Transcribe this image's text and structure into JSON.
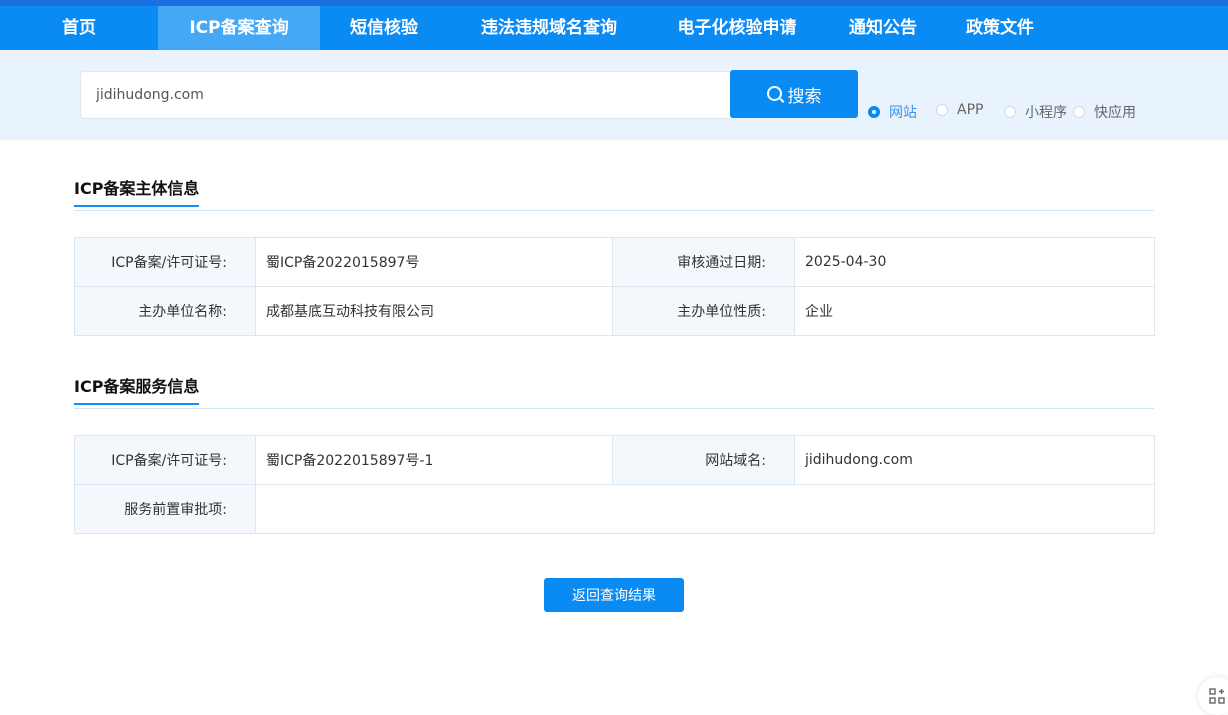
{
  "nav": {
    "items": [
      {
        "label": "首页",
        "active": false
      },
      {
        "label": "ICP备案查询",
        "active": true
      },
      {
        "label": "短信核验",
        "active": false
      },
      {
        "label": "违法违规域名查询",
        "active": false
      },
      {
        "label": "电子化核验申请",
        "active": false
      },
      {
        "label": "通知公告",
        "active": false
      },
      {
        "label": "政策文件",
        "active": false
      }
    ]
  },
  "search": {
    "value": "jidihudong.com",
    "button_label": "搜索",
    "types": [
      {
        "label": "网站",
        "checked": true
      },
      {
        "label": "APP",
        "checked": false
      },
      {
        "label": "小程序",
        "checked": false
      },
      {
        "label": "快应用",
        "checked": false
      }
    ]
  },
  "entity_info": {
    "title": "ICP备案主体信息",
    "license_label": "ICP备案/许可证号:",
    "license_value": "蜀ICP备2022015897号",
    "approval_date_label": "审核通过日期:",
    "approval_date_value": "2025-04-30",
    "org_name_label": "主办单位名称:",
    "org_name_value": "成都基底互动科技有限公司",
    "org_type_label": "主办单位性质:",
    "org_type_value": "企业"
  },
  "service_info": {
    "title": "ICP备案服务信息",
    "license_label": "ICP备案/许可证号:",
    "license_value": "蜀ICP备2022015897号-1",
    "domain_label": "网站域名:",
    "domain_value": "jidihudong.com",
    "pre_approval_label": "服务前置审批项:",
    "pre_approval_value": ""
  },
  "back_button_label": "返回查询结果",
  "colors": {
    "primary": "#0a8af3",
    "nav_active": "#45a8f7",
    "search_band": "#e8f3fd",
    "label_cell": "#f4f8fc"
  }
}
